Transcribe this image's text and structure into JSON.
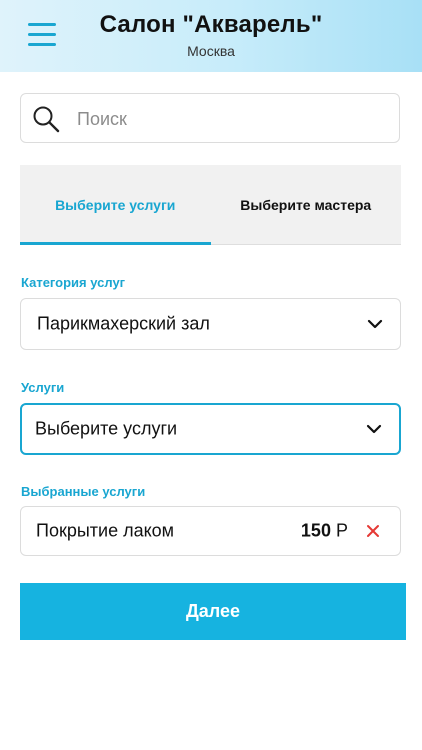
{
  "header": {
    "title": "Салон \"Акварель\"",
    "subtitle": "Москва",
    "menu_icon": "hamburger-menu-icon"
  },
  "search": {
    "placeholder": "Поиск",
    "value": "",
    "icon": "search-icon"
  },
  "tabs": [
    {
      "label": "Выберите услуги",
      "active": true
    },
    {
      "label": "Выберите мастера",
      "active": false
    }
  ],
  "category": {
    "label": "Категория услуг",
    "selected": "Парикмахерский зал"
  },
  "services": {
    "label": "Услуги",
    "selected": "Выберите услуги"
  },
  "selected_services": {
    "label": "Выбранные услуги",
    "items": [
      {
        "name": "Покрытие лаком",
        "price": "150",
        "currency": "Р"
      }
    ]
  },
  "next_button": {
    "label": "Далее"
  },
  "colors": {
    "accent": "#19a6d1",
    "button": "#16b3e0",
    "remove": "#e53935",
    "header_gradient_start": "#dff3fb",
    "header_gradient_end": "#a8e0f6"
  }
}
